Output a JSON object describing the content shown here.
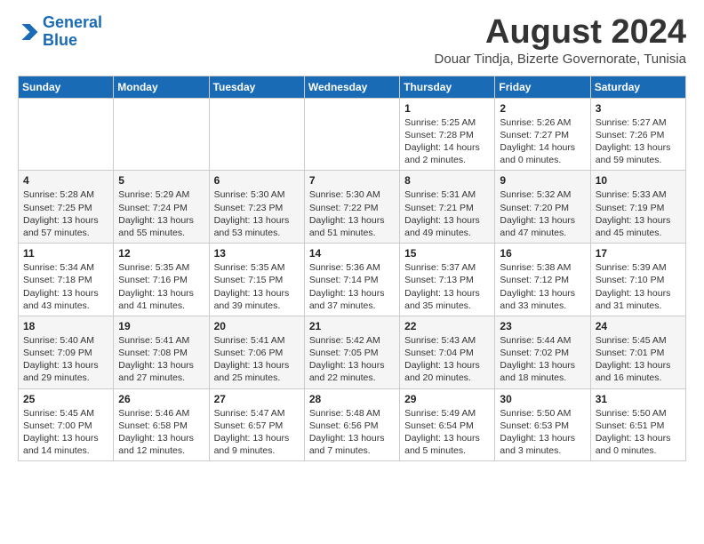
{
  "logo": {
    "line1": "General",
    "line2": "Blue"
  },
  "title": "August 2024",
  "location": "Douar Tindja, Bizerte Governorate, Tunisia",
  "weekdays": [
    "Sunday",
    "Monday",
    "Tuesday",
    "Wednesday",
    "Thursday",
    "Friday",
    "Saturday"
  ],
  "weeks": [
    [
      {
        "day": "",
        "info": ""
      },
      {
        "day": "",
        "info": ""
      },
      {
        "day": "",
        "info": ""
      },
      {
        "day": "",
        "info": ""
      },
      {
        "day": "1",
        "info": "Sunrise: 5:25 AM\nSunset: 7:28 PM\nDaylight: 14 hours\nand 2 minutes."
      },
      {
        "day": "2",
        "info": "Sunrise: 5:26 AM\nSunset: 7:27 PM\nDaylight: 14 hours\nand 0 minutes."
      },
      {
        "day": "3",
        "info": "Sunrise: 5:27 AM\nSunset: 7:26 PM\nDaylight: 13 hours\nand 59 minutes."
      }
    ],
    [
      {
        "day": "4",
        "info": "Sunrise: 5:28 AM\nSunset: 7:25 PM\nDaylight: 13 hours\nand 57 minutes."
      },
      {
        "day": "5",
        "info": "Sunrise: 5:29 AM\nSunset: 7:24 PM\nDaylight: 13 hours\nand 55 minutes."
      },
      {
        "day": "6",
        "info": "Sunrise: 5:30 AM\nSunset: 7:23 PM\nDaylight: 13 hours\nand 53 minutes."
      },
      {
        "day": "7",
        "info": "Sunrise: 5:30 AM\nSunset: 7:22 PM\nDaylight: 13 hours\nand 51 minutes."
      },
      {
        "day": "8",
        "info": "Sunrise: 5:31 AM\nSunset: 7:21 PM\nDaylight: 13 hours\nand 49 minutes."
      },
      {
        "day": "9",
        "info": "Sunrise: 5:32 AM\nSunset: 7:20 PM\nDaylight: 13 hours\nand 47 minutes."
      },
      {
        "day": "10",
        "info": "Sunrise: 5:33 AM\nSunset: 7:19 PM\nDaylight: 13 hours\nand 45 minutes."
      }
    ],
    [
      {
        "day": "11",
        "info": "Sunrise: 5:34 AM\nSunset: 7:18 PM\nDaylight: 13 hours\nand 43 minutes."
      },
      {
        "day": "12",
        "info": "Sunrise: 5:35 AM\nSunset: 7:16 PM\nDaylight: 13 hours\nand 41 minutes."
      },
      {
        "day": "13",
        "info": "Sunrise: 5:35 AM\nSunset: 7:15 PM\nDaylight: 13 hours\nand 39 minutes."
      },
      {
        "day": "14",
        "info": "Sunrise: 5:36 AM\nSunset: 7:14 PM\nDaylight: 13 hours\nand 37 minutes."
      },
      {
        "day": "15",
        "info": "Sunrise: 5:37 AM\nSunset: 7:13 PM\nDaylight: 13 hours\nand 35 minutes."
      },
      {
        "day": "16",
        "info": "Sunrise: 5:38 AM\nSunset: 7:12 PM\nDaylight: 13 hours\nand 33 minutes."
      },
      {
        "day": "17",
        "info": "Sunrise: 5:39 AM\nSunset: 7:10 PM\nDaylight: 13 hours\nand 31 minutes."
      }
    ],
    [
      {
        "day": "18",
        "info": "Sunrise: 5:40 AM\nSunset: 7:09 PM\nDaylight: 13 hours\nand 29 minutes."
      },
      {
        "day": "19",
        "info": "Sunrise: 5:41 AM\nSunset: 7:08 PM\nDaylight: 13 hours\nand 27 minutes."
      },
      {
        "day": "20",
        "info": "Sunrise: 5:41 AM\nSunset: 7:06 PM\nDaylight: 13 hours\nand 25 minutes."
      },
      {
        "day": "21",
        "info": "Sunrise: 5:42 AM\nSunset: 7:05 PM\nDaylight: 13 hours\nand 22 minutes."
      },
      {
        "day": "22",
        "info": "Sunrise: 5:43 AM\nSunset: 7:04 PM\nDaylight: 13 hours\nand 20 minutes."
      },
      {
        "day": "23",
        "info": "Sunrise: 5:44 AM\nSunset: 7:02 PM\nDaylight: 13 hours\nand 18 minutes."
      },
      {
        "day": "24",
        "info": "Sunrise: 5:45 AM\nSunset: 7:01 PM\nDaylight: 13 hours\nand 16 minutes."
      }
    ],
    [
      {
        "day": "25",
        "info": "Sunrise: 5:45 AM\nSunset: 7:00 PM\nDaylight: 13 hours\nand 14 minutes."
      },
      {
        "day": "26",
        "info": "Sunrise: 5:46 AM\nSunset: 6:58 PM\nDaylight: 13 hours\nand 12 minutes."
      },
      {
        "day": "27",
        "info": "Sunrise: 5:47 AM\nSunset: 6:57 PM\nDaylight: 13 hours\nand 9 minutes."
      },
      {
        "day": "28",
        "info": "Sunrise: 5:48 AM\nSunset: 6:56 PM\nDaylight: 13 hours\nand 7 minutes."
      },
      {
        "day": "29",
        "info": "Sunrise: 5:49 AM\nSunset: 6:54 PM\nDaylight: 13 hours\nand 5 minutes."
      },
      {
        "day": "30",
        "info": "Sunrise: 5:50 AM\nSunset: 6:53 PM\nDaylight: 13 hours\nand 3 minutes."
      },
      {
        "day": "31",
        "info": "Sunrise: 5:50 AM\nSunset: 6:51 PM\nDaylight: 13 hours\nand 0 minutes."
      }
    ]
  ]
}
